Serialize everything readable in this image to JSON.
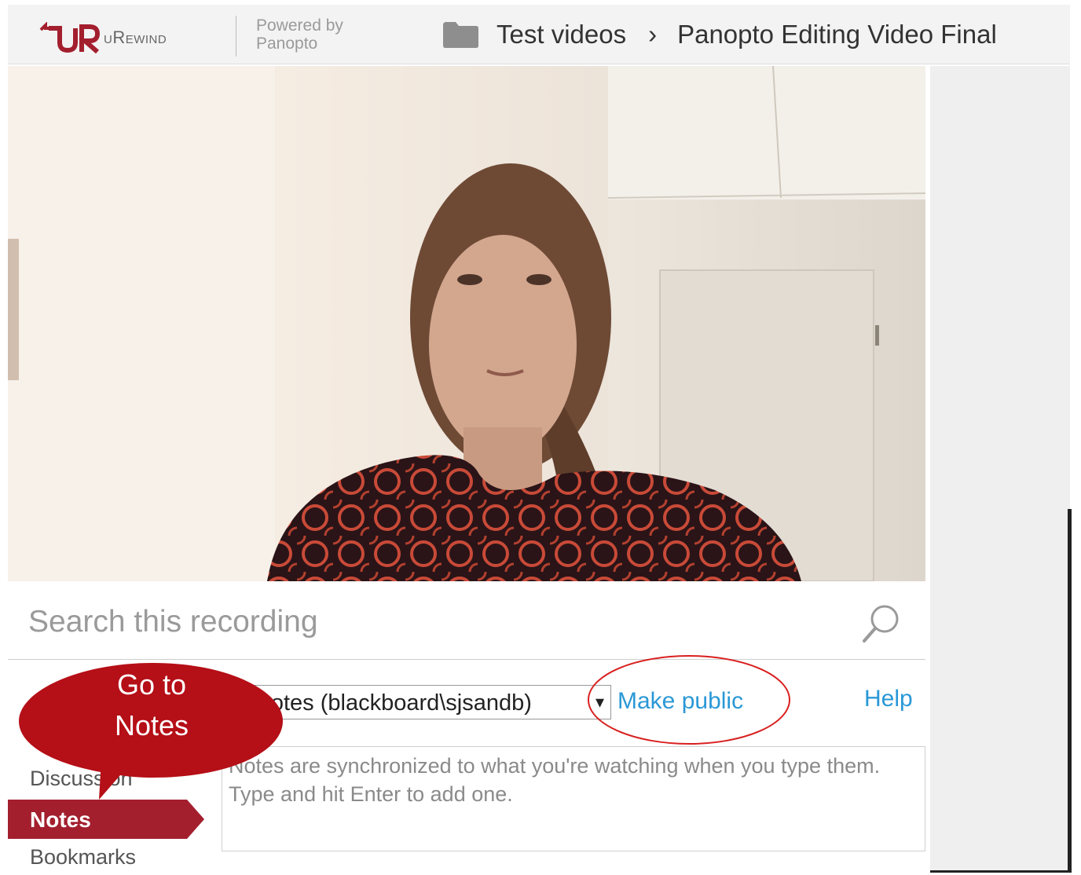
{
  "header": {
    "brand": "uRewind",
    "powered_by_line1": "Powered by",
    "powered_by_line2": "Panopto",
    "breadcrumb_folder": "Test videos",
    "breadcrumb_separator": "›",
    "breadcrumb_title": "Panopto Editing Video Final"
  },
  "search": {
    "placeholder": "Search this recording",
    "icon": "search-icon"
  },
  "tabs": {
    "discussion": "Discussion",
    "notes": "Notes",
    "bookmarks": "Bookmarks"
  },
  "notes": {
    "channel_value": "r notes (blackboard\\sjsandb)",
    "caret": "▾",
    "make_public": "Make public",
    "help": "Help",
    "input_placeholder": "Notes are synchronized to what you're watching when you type them. Type and hit Enter to add one."
  },
  "annotation": {
    "callout_line1": "Go to",
    "callout_line2": "Notes"
  },
  "colors": {
    "accent_red": "#a31f2e",
    "callout_red": "#b50f17",
    "link_blue": "#2a98d6",
    "circle_red": "#d92020"
  }
}
